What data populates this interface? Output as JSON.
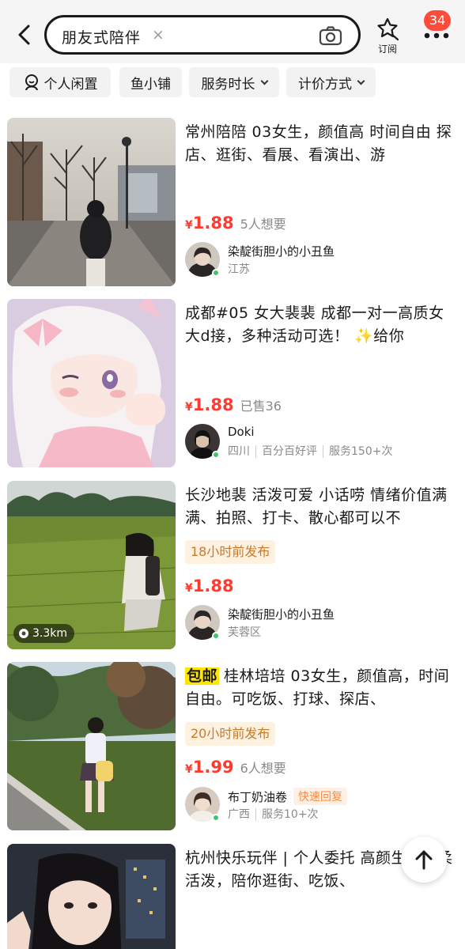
{
  "header": {
    "search_query": "朋友式陪伴",
    "clear_symbol": "×",
    "subscribe_label": "订阅",
    "message_count": "34"
  },
  "filters": [
    {
      "label": "个人闲置",
      "icon": "person-icon"
    },
    {
      "label": "鱼小铺"
    },
    {
      "label": "服务时长",
      "has_dropdown": true
    },
    {
      "label": "计价方式",
      "has_dropdown": true
    }
  ],
  "listings": [
    {
      "title": "常州陪陪 03女生，颜值高 时间自由 探店、逛街、看展、看演出、游",
      "currency": "¥",
      "price": "1.88",
      "interest": "5人想要",
      "seller_name": "染靛街胆小的小丑鱼",
      "seller_region": "江苏"
    },
    {
      "title": "成都#05 女大裴裴 成都一对一高质女大d接，多种活动可选！ ✨给你",
      "currency": "¥",
      "price": "1.88",
      "interest": "已售36",
      "seller_name": "Doki",
      "seller_region": "四川",
      "seller_rating": "百分百好评",
      "seller_served": "服务150+次"
    },
    {
      "title": "长沙地裴 活泼可爱 小话唠 情绪价值满满、拍照、打卡、散心都可以不",
      "time_tag": "18小时前发布",
      "currency": "¥",
      "price": "1.88",
      "distance": "3.3km",
      "seller_name": "染靛街胆小的小丑鱼",
      "seller_region": "芙蓉区"
    },
    {
      "badge": "包邮",
      "title": "桂林培培 03女生，颜值高，时间自由。可吃饭、打球、探店、",
      "time_tag": "20小时前发布",
      "currency": "¥",
      "price": "1.99",
      "interest": "6人想要",
      "seller_name": "布丁奶油卷",
      "seller_tag": "快速回复",
      "seller_region": "广西",
      "seller_served": "服务10+次"
    },
    {
      "title": "杭州快乐玩伴 | 个人委托 高颜生，温柔活泼，陪你逛街、吃饭、"
    }
  ],
  "colors": {
    "price": "#ff3b30",
    "badge": "#ff4b3a",
    "time_tag_bg": "#fff1e0",
    "time_tag_text": "#c87a2c",
    "online": "#3cc76b",
    "tag_yellow": "#ffe600"
  }
}
